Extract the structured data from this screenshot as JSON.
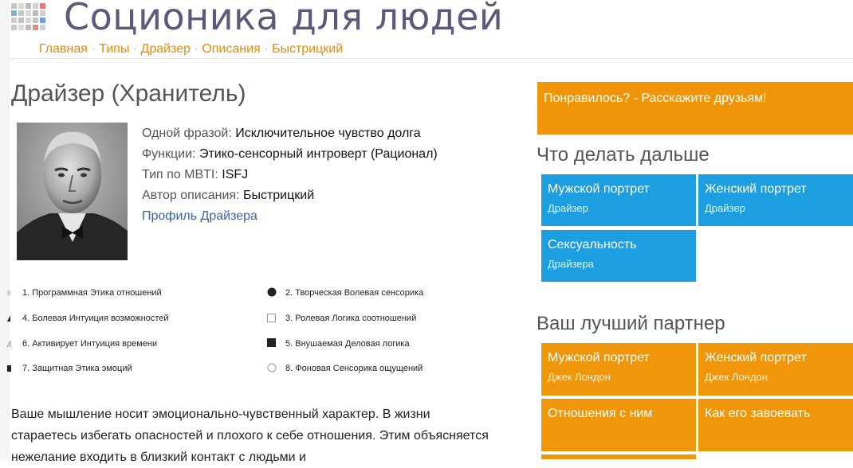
{
  "header": {
    "site_title": "Соционика для людей",
    "nav": [
      "Главная",
      "Типы",
      "Драйзер",
      "Описания",
      "Быстрицкий"
    ],
    "nav_separator": "·"
  },
  "main": {
    "title": "Драйзер (Хранитель)",
    "info": {
      "phrase_label": "Одной фразой:",
      "phrase_value": "Исключительное чувство долга",
      "functions_label": "Функции:",
      "functions_value": "Этико-сенсорный интроверт (Рационал)",
      "mbti_label": "Тип по MBTI:",
      "mbti_value": "ISFJ",
      "author_label": "Автор описания:",
      "author_value": "Быстрицкий",
      "profile_link": "Профиль Драйзера"
    },
    "functions": [
      {
        "label": "1. Программная Этика отношений",
        "icon": "cut-off-marker-icon"
      },
      {
        "label": "2. Творческая Волевая сенсорика",
        "icon": "filled-circle-icon"
      },
      {
        "label": "4. Болевая Интуиция возможностей",
        "icon": "cut-off-marker-icon"
      },
      {
        "label": "3. Ролевая Логика соотношений",
        "icon": "empty-square-icon"
      },
      {
        "label": "6. Активирует Интуиция времени",
        "icon": "cut-off-marker-icon"
      },
      {
        "label": "5. Внушаемая Деловая логика",
        "icon": "filled-square-icon"
      },
      {
        "label": "7. Защитная Этика эмоций",
        "icon": "cut-off-marker-icon"
      },
      {
        "label": "8. Фоновая Сенсорика ощущений",
        "icon": "empty-circle-icon"
      }
    ],
    "paragraph": "Ваше мышление носит эмоционально-чувственный характер. В жизни стараетесь избегать опасностей и плохого к себе отношения. Этим объясняется нежелание входить в близкий контакт с людьми и"
  },
  "sidebar": {
    "share": "Понравилось? - Расскажите друзьям!",
    "next_heading": "Что делать дальше",
    "next_tiles": [
      {
        "title": "Мужской портрет",
        "subtitle": "Драйзер"
      },
      {
        "title": "Женский портрет",
        "subtitle": "Драйзер"
      },
      {
        "title": "Сексуальность",
        "subtitle": "Драйзера"
      }
    ],
    "partner_heading": "Ваш лучший партнер",
    "partner_tiles": [
      {
        "title": "Мужской портрет",
        "subtitle": "Джек Лондон"
      },
      {
        "title": "Женский портрет",
        "subtitle": "Джек Лондон"
      },
      {
        "title": "Отношения с ним",
        "subtitle": ""
      },
      {
        "title": "Как его завоевать",
        "subtitle": ""
      }
    ]
  },
  "colors": {
    "accent_orange": "#ef960b",
    "accent_blue": "#1d9ee0",
    "title_color": "#5b5a78",
    "link_blue": "#3a63a8",
    "nav_orange": "#e88a06"
  },
  "logo_colors": [
    "#c5c5c5",
    "#d8d8d8",
    "#bdbdbd",
    "#cfcfcf",
    "#e07a7a",
    "#7fb0e0",
    "#c8c8c8",
    "#dadada",
    "#bababa",
    "#d2d2d2",
    "#cdcdcd",
    "#c0c0c0",
    "#d5d5d5",
    "#c4c4c4",
    "#6f9fd8",
    "#cacaca",
    "#dcdcdc",
    "#bebebe",
    "#e08a8a",
    "#d0d0d0"
  ]
}
